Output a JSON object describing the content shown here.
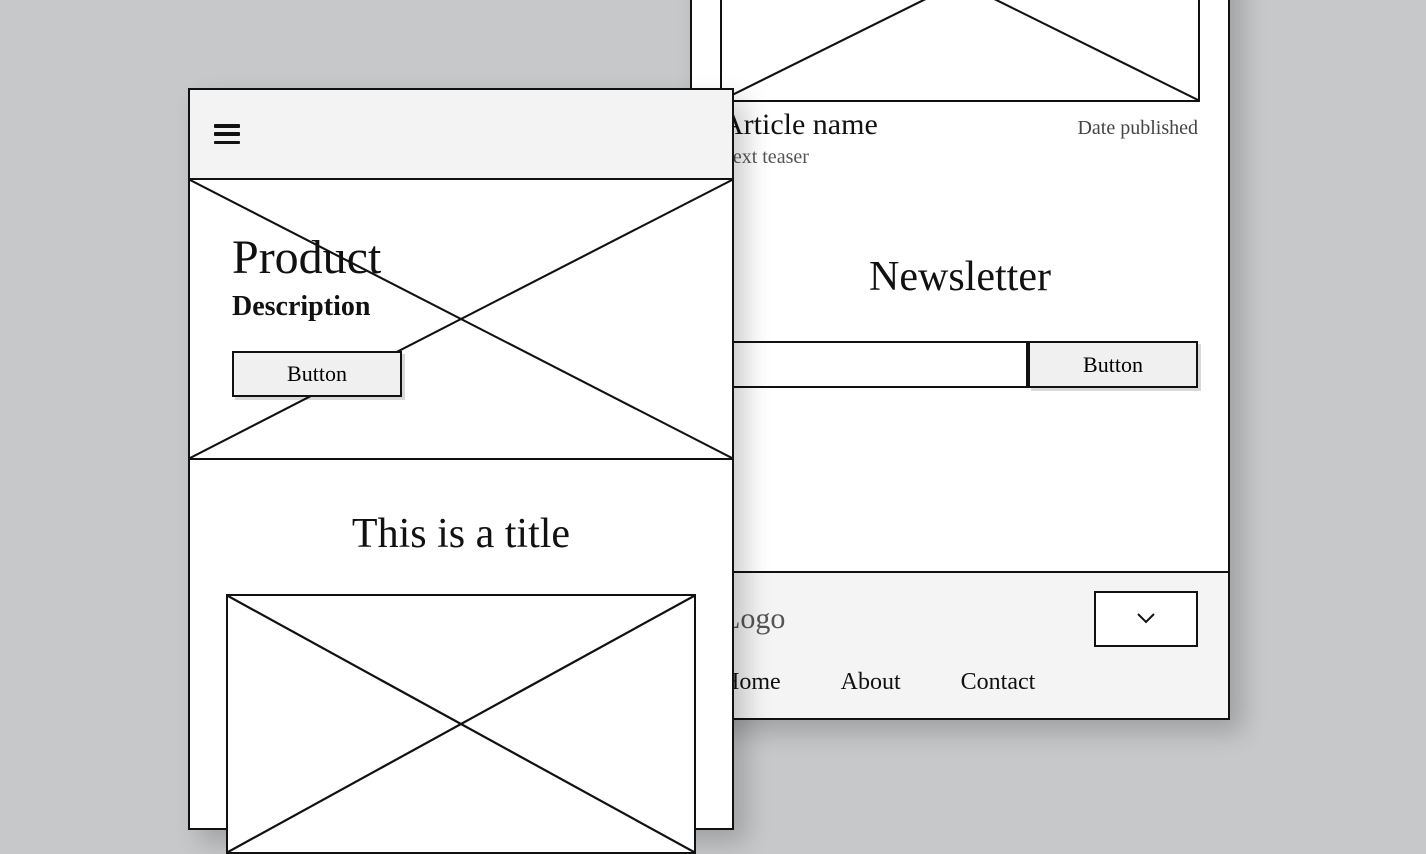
{
  "back": {
    "article": {
      "name": "Article name",
      "date": "Date published",
      "teaser": "Text teaser"
    },
    "newsletter": {
      "heading": "Newsletter",
      "button": "Button"
    },
    "footer": {
      "logo": "Logo",
      "nav": {
        "home": "Home",
        "about": "About",
        "contact": "Contact"
      }
    }
  },
  "front": {
    "hero": {
      "title": "Product",
      "description": "Description",
      "button": "Button"
    },
    "section_title": "This is a title"
  }
}
